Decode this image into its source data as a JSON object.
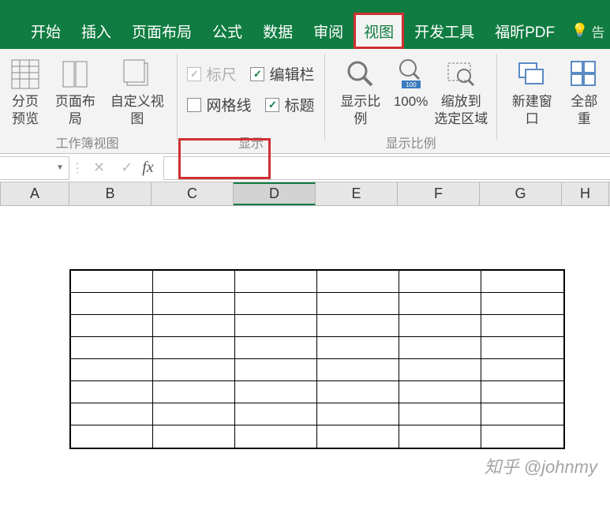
{
  "tabs": {
    "home": "开始",
    "insert": "插入",
    "page_layout": "页面布局",
    "formulas": "公式",
    "data": "数据",
    "review": "审阅",
    "view": "视图",
    "developer": "开发工具",
    "foxit": "福昕PDF",
    "tell_me": "告"
  },
  "ribbon": {
    "views": {
      "page_break": "分页\n预览",
      "page_layout": "页面布局",
      "custom_views": "自定义视图",
      "group_label": "工作簿视图"
    },
    "show": {
      "ruler": "标尺",
      "formula_bar": "编辑栏",
      "gridlines": "网格线",
      "headings": "标题",
      "group_label": "显示"
    },
    "zoom": {
      "zoom": "显示比例",
      "hundred": "100%",
      "zoom_to_selection": "缩放到\n选定区域",
      "group_label": "显示比例"
    },
    "window": {
      "new_window": "新建窗口",
      "arrange_all": "全部重"
    }
  },
  "columns": [
    "A",
    "B",
    "C",
    "D",
    "E",
    "F",
    "G",
    "H"
  ],
  "selected_col": "D",
  "watermark": "知乎 @johnmy"
}
